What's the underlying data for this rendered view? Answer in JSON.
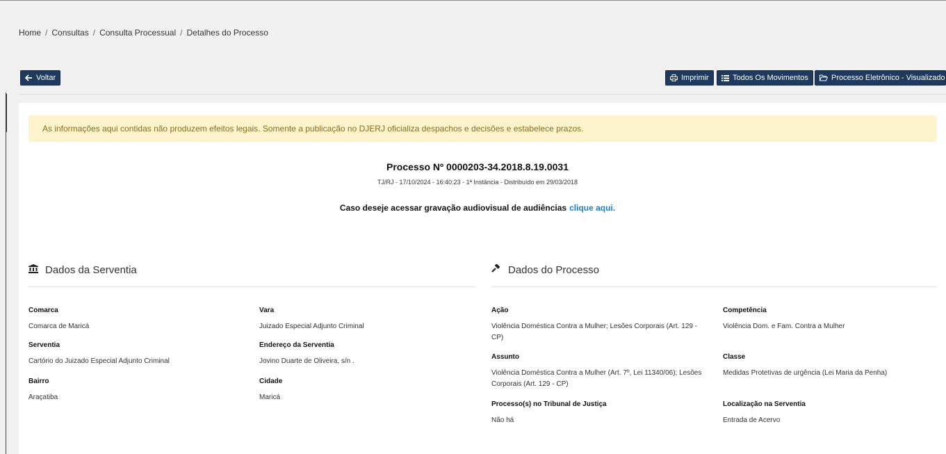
{
  "breadcrumb": {
    "items": [
      "Home",
      "Consultas",
      "Consulta Processual",
      "Detalhes do Processo"
    ],
    "separator": "/"
  },
  "toolbar": {
    "back_label": "Voltar",
    "print_label": "Imprimir",
    "movements_label": "Todos Os Movimentos",
    "electronic_label": "Processo Eletrônico - Visualizador"
  },
  "alert": {
    "text": "As informações aqui contidas não produzem efeitos legais. Somente a publicação no DJERJ oficializa despachos e decisões e estabelece prazos."
  },
  "process": {
    "title": "Processo Nº 0000203-34.2018.8.19.0031",
    "subtitle": "TJ/RJ - 17/10/2024 - 16:40:23 - 1ª Instância - Distribuído em 29/03/2018",
    "audio_text": "Caso deseje acessar gravação audiovisual de audiências",
    "audio_link": "clique aqui."
  },
  "serventia": {
    "heading": "Dados da Serventia",
    "comarca_label": "Comarca",
    "comarca_value": "Comarca de Maricá",
    "vara_label": "Vara",
    "vara_value": "Juizado Especial Adjunto Criminal",
    "serventia_label": "Serventia",
    "serventia_value": "Cartório do Juizado Especial Adjunto Criminal",
    "endereco_label": "Endereço da Serventia",
    "endereco_value": "Jovino Duarte de Oliveira, s/n .",
    "bairro_label": "Bairro",
    "bairro_value": "Araçatiba",
    "cidade_label": "Cidade",
    "cidade_value": "Maricá"
  },
  "processo": {
    "heading": "Dados do Processo",
    "acao_label": "Ação",
    "acao_value": "Violência Doméstica Contra a Mulher; Lesões Corporais (Art. 129 - CP)",
    "competencia_label": "Competência",
    "competencia_value": "Violência Dom. e Fam. Contra a Mulher",
    "assunto_label": "Assunto",
    "assunto_value": "Violência Doméstica Contra a Mulher (Art. 7º, Lei 11340/06); Lesões Corporais (Art. 129 - CP)",
    "classe_label": "Classe",
    "classe_value": "Medidas Protetivas de urgência (Lei Maria da Penha)",
    "tribunal_label": "Processo(s) no Tribunal de Justiça",
    "tribunal_value": "Não há",
    "localizacao_label": "Localização na Serventia",
    "localizacao_value": "Entrada de Acervo"
  },
  "icons": {
    "back": "arrow-left-icon",
    "print": "printer-icon",
    "movements": "list-icon",
    "electronic": "folder-open-icon",
    "serventia": "bank-icon",
    "processo": "gavel-icon"
  },
  "colors": {
    "button_bg": "#1f3a5f",
    "alert_bg": "#fdf3cc",
    "alert_text": "#8a6d1d",
    "link": "#1a7fd4"
  }
}
